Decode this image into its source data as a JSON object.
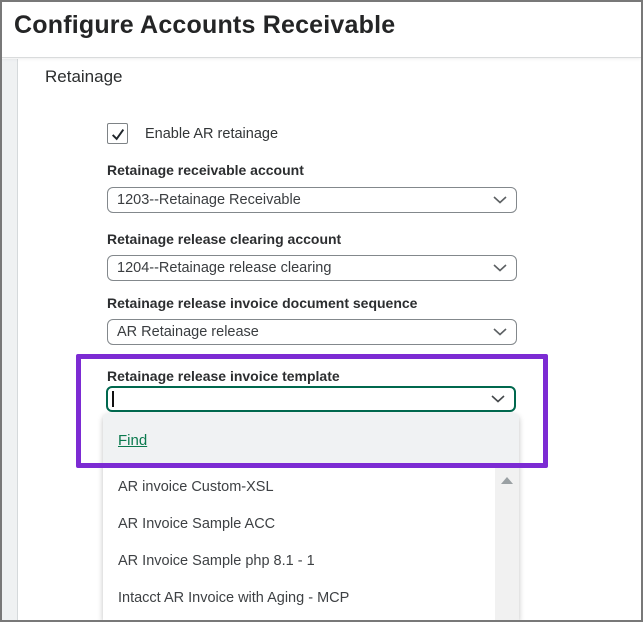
{
  "window": {
    "title": "Configure Accounts Receivable"
  },
  "section": {
    "heading": "Retainage",
    "checkbox": {
      "label": "Enable AR retainage",
      "checked": true
    },
    "fields": [
      {
        "label": "Retainage receivable account",
        "value": "1203--Retainage Receivable"
      },
      {
        "label": "Retainage release clearing account",
        "value": "1204--Retainage release clearing"
      },
      {
        "label": "Retainage release invoice document sequence",
        "value": "AR Retainage release"
      },
      {
        "label": "Retainage release invoice template",
        "value": ""
      }
    ]
  },
  "dropdown": {
    "find_label": "Find",
    "options": [
      "AR invoice Custom-XSL",
      "AR Invoice Sample ACC",
      "AR Invoice Sample php 8.1 - 1",
      "Intacct AR Invoice with Aging - MCP"
    ]
  },
  "icons": {
    "chevron": "chevron-down-icon",
    "checkmark": "checkmark-icon",
    "scroll_up": "scroll-up-arrow-icon"
  },
  "colors": {
    "focus_border_green": "#00684e",
    "find_link_green": "#0b7a4e",
    "annotation_purple": "#7c2bd3",
    "gutter_gray": "#eff1f2",
    "panel_header_gray": "#f0f2f3"
  }
}
